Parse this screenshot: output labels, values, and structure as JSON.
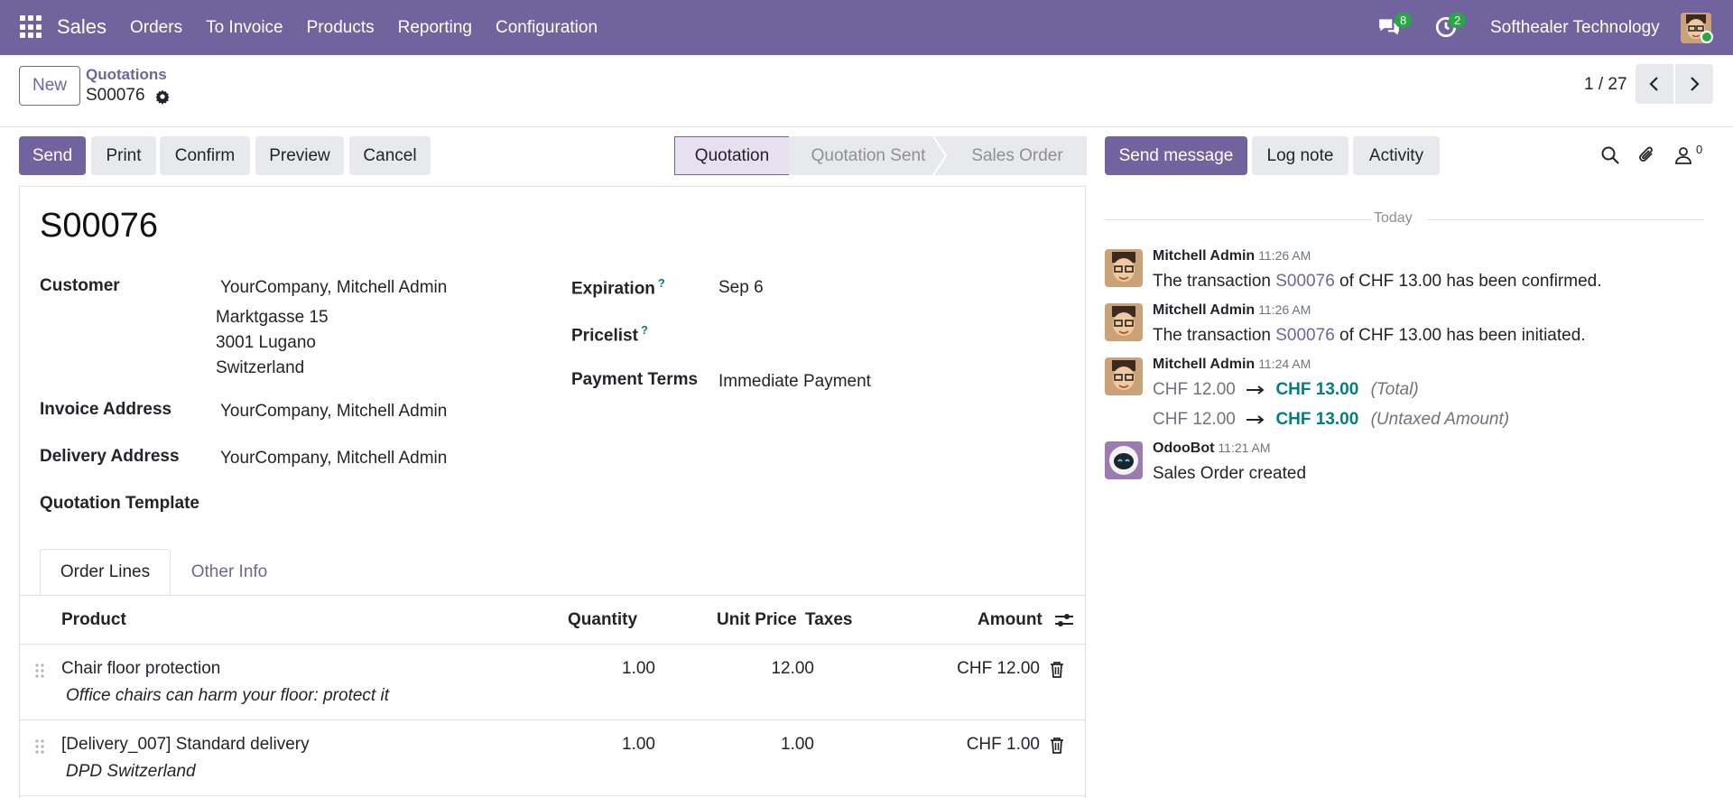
{
  "navbar": {
    "app_name": "Sales",
    "menu": [
      "Orders",
      "To Invoice",
      "Products",
      "Reporting",
      "Configuration"
    ],
    "messages_count": "8",
    "activities_count": "2",
    "company": "Softhealer Technology"
  },
  "control": {
    "new_label": "New",
    "breadcrumb_parent": "Quotations",
    "breadcrumb_current": "S00076",
    "pager": "1 / 27"
  },
  "actions": {
    "send": "Send",
    "print": "Print",
    "confirm": "Confirm",
    "preview": "Preview",
    "cancel": "Cancel"
  },
  "statusbar": {
    "stages": [
      "Quotation",
      "Quotation Sent",
      "Sales Order"
    ],
    "active": "Quotation"
  },
  "form": {
    "name": "S00076",
    "customer_label": "Customer",
    "customer_name": "YourCompany, Mitchell Admin",
    "customer_street": "Marktgasse 15",
    "customer_city": "3001 Lugano",
    "customer_country": "Switzerland",
    "invoice_label": "Invoice Address",
    "invoice_value": "YourCompany, Mitchell Admin",
    "delivery_label": "Delivery Address",
    "delivery_value": "YourCompany, Mitchell Admin",
    "template_label": "Quotation Template",
    "expiration_label": "Expiration",
    "expiration_value": "Sep 6",
    "pricelist_label": "Pricelist",
    "payment_terms_label": "Payment Terms",
    "payment_terms_value": "Immediate Payment",
    "help_mark": "?"
  },
  "tabs": {
    "order_lines": "Order Lines",
    "other_info": "Other Info"
  },
  "table": {
    "headers": {
      "product": "Product",
      "quantity": "Quantity",
      "unit_price": "Unit Price",
      "taxes": "Taxes",
      "amount": "Amount"
    },
    "rows": [
      {
        "product": "Chair floor protection",
        "note": "Office chairs can harm your floor: protect it",
        "quantity": "1.00",
        "unit_price": "12.00",
        "amount": "CHF 12.00"
      },
      {
        "product": "[Delivery_007] Standard delivery",
        "note": "DPD Switzerland",
        "quantity": "1.00",
        "unit_price": "1.00",
        "amount": "CHF 1.00"
      }
    ]
  },
  "chatter": {
    "send_message": "Send message",
    "log_note": "Log note",
    "activity": "Activity",
    "followers_count": "0",
    "today": "Today",
    "messages": [
      {
        "author": "Mitchell Admin",
        "time": "11:26 AM",
        "pre": "The transaction ",
        "link": "S00076",
        "post": " of CHF 13.00 has been confirmed."
      },
      {
        "author": "Mitchell Admin",
        "time": "11:26 AM",
        "pre": "The transaction ",
        "link": "S00076",
        "post": " of CHF 13.00 has been initiated."
      },
      {
        "author": "Mitchell Admin",
        "time": "11:24 AM",
        "changes": [
          {
            "old": "CHF 12.00",
            "new": "CHF 13.00",
            "field": "(Total)"
          },
          {
            "old": "CHF 12.00",
            "new": "CHF 13.00",
            "field": "(Untaxed Amount)"
          }
        ]
      },
      {
        "author": "OdooBot",
        "time": "11:21 AM",
        "body": "Sales Order created"
      }
    ]
  },
  "colors": {
    "brand": "#71639e",
    "accent": "#017e84",
    "badge": "#28a745"
  }
}
